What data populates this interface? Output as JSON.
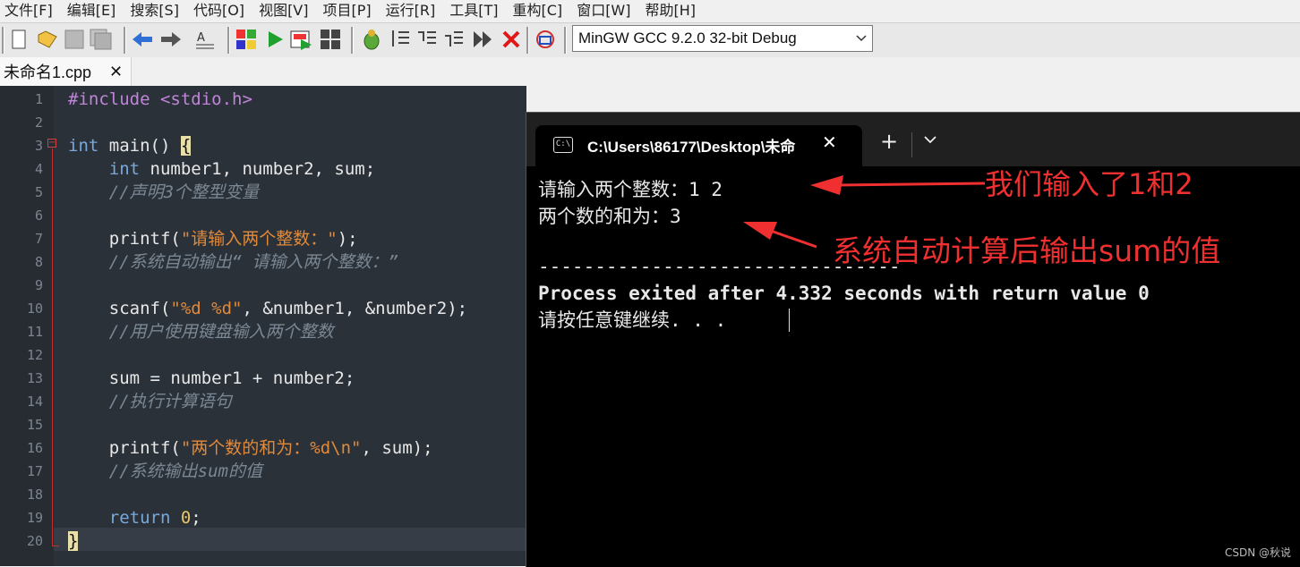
{
  "menu": [
    "文件[F]",
    "编辑[E]",
    "搜索[S]",
    "代码[O]",
    "视图[V]",
    "项目[P]",
    "运行[R]",
    "工具[T]",
    "重构[C]",
    "窗口[W]",
    "帮助[H]"
  ],
  "toolbar": {
    "compiler": "MinGW GCC 9.2.0 32-bit Debug",
    "icons": [
      "new-file-icon",
      "open-icon",
      "save-icon",
      "save-all-icon",
      "back-icon",
      "forward-icon",
      "format-icon",
      "compile-icon",
      "run-icon",
      "compile-run-icon",
      "rebuild-icon",
      "debug-icon",
      "step-icon",
      "step-into-icon",
      "step-out-icon",
      "continue-icon",
      "stop-icon",
      "profile-icon"
    ]
  },
  "tab": {
    "name": "未命名1.cpp",
    "close": "✕"
  },
  "editor": {
    "line_numbers": [
      "1",
      "2",
      "3",
      "4",
      "5",
      "6",
      "7",
      "8",
      "9",
      "10",
      "11",
      "12",
      "13",
      "14",
      "15",
      "16",
      "17",
      "18",
      "19",
      "20"
    ],
    "lines": {
      "l1a": "#include",
      "l1b": " <stdio.h>",
      "l3a": "int",
      "l3b": " main() ",
      "l3c": "{",
      "l4a": "    int",
      "l4b": " number1, number2, sum;",
      "l5": "    //声明3个整型变量",
      "l7a": "    printf(",
      "l7b": "\"请输入两个整数：\"",
      "l7c": ");",
      "l8": "    //系统自动输出“ 请输入两个整数：”",
      "l10a": "    scanf(",
      "l10b": "\"%d %d\"",
      "l10c": ", &number1, &number2);",
      "l11": "    //用户使用键盘输入两个整数",
      "l13": "    sum = number1 + number2;",
      "l14": "    //执行计算语句",
      "l16a": "    printf(",
      "l16b": "\"两个数的和为：%d\\n\"",
      "l16c": ", sum);",
      "l17": "    //系统输出sum的值",
      "l19a": "    return ",
      "l19b": "0",
      "l19c": ";",
      "l20": "}"
    }
  },
  "terminal": {
    "title": "C:\\Users\\86177\\Desktop\\未命",
    "close": "✕",
    "new_tab": "+",
    "dropdown": "⌄",
    "lines": {
      "t1": "请输入两个整数：1 2",
      "t2": "两个数的和为：3",
      "t3": "--------------------------------",
      "t4": "Process exited after 4.332 seconds with return value 0",
      "t5": "请按任意键继续. . ."
    }
  },
  "annotations": {
    "a1": "我们输入了1和2",
    "a2": "系统自动计算后输出sum的值",
    "color": "#f03030"
  },
  "watermark": "CSDN @秋说"
}
